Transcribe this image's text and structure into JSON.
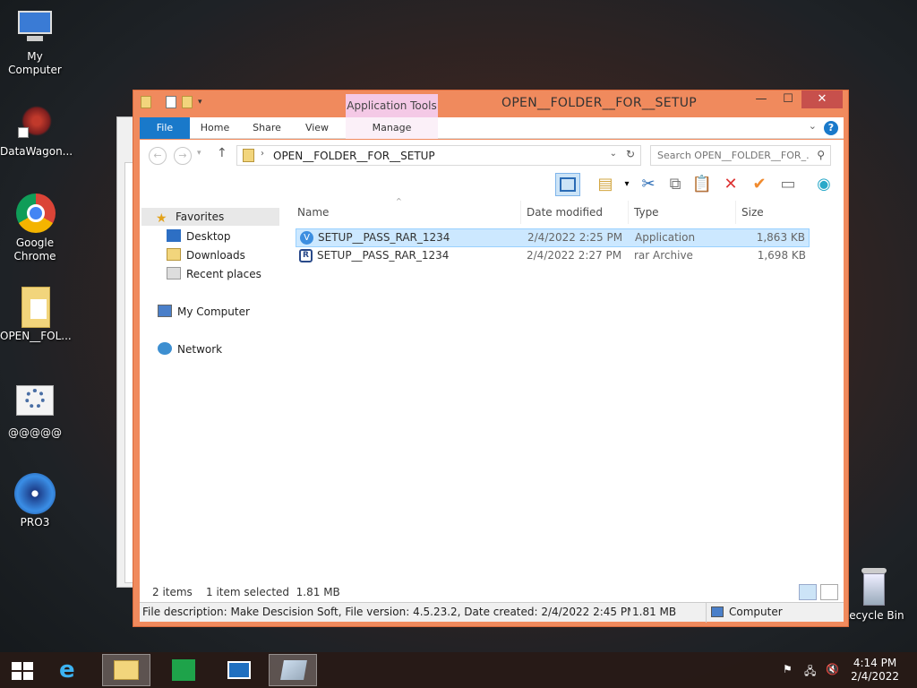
{
  "desktop": {
    "icons": [
      {
        "label": "My Computer",
        "icon": "computer-icon"
      },
      {
        "label": "DataWagon...",
        "icon": "datawagon-icon"
      },
      {
        "label": "Google Chrome",
        "icon": "chrome-icon"
      },
      {
        "label": "OPEN__FOL...",
        "icon": "folder-icon"
      },
      {
        "label": "@@@@@",
        "icon": "settings-gear-icon"
      },
      {
        "label": "PRO3",
        "icon": "disc-icon"
      },
      {
        "label": "Recycle Bin",
        "icon": "recycle-bin-icon"
      }
    ]
  },
  "window": {
    "title": "OPEN__FOLDER__FOR__SETUP",
    "context_tab_group": "Application Tools",
    "tabs": {
      "file": "File",
      "home": "Home",
      "share": "Share",
      "view": "View",
      "manage": "Manage"
    },
    "help": "?",
    "address": {
      "path": "OPEN__FOLDER__FOR__SETUP",
      "search_placeholder": "Search OPEN__FOLDER__FOR_..."
    },
    "nav": {
      "favorites": "Favorites",
      "desktop": "Desktop",
      "downloads": "Downloads",
      "recent": "Recent places",
      "computer": "My Computer",
      "network": "Network"
    },
    "columns": {
      "name": "Name",
      "date": "Date modified",
      "type": "Type",
      "size": "Size"
    },
    "files": [
      {
        "name": "SETUP__PASS_RAR_1234",
        "date": "2/4/2022 2:25 PM",
        "type": "Application",
        "size": "1,863 KB",
        "selected": true
      },
      {
        "name": "SETUP__PASS_RAR_1234",
        "date": "2/4/2022 2:27 PM",
        "type": "rar Archive",
        "size": "1,698 KB",
        "selected": false
      }
    ],
    "status": {
      "count": "2 items",
      "selection": "1 item selected  1.81 MB"
    },
    "details": {
      "description": "File description: Make Descision Soft, File version: 4.5.23.2, Date created: 2/4/2022 2:45 PM, Size: 1.81 MB",
      "size": "1.81 MB",
      "location": "Computer"
    }
  },
  "taskbar": {
    "time": "4:14 PM",
    "date": "2/4/2022"
  },
  "colors": {
    "window_frame": "#f08a5d",
    "file_tab": "#1979ca",
    "context_tab": "#f4c9e6",
    "selection": "#cce8ff"
  }
}
